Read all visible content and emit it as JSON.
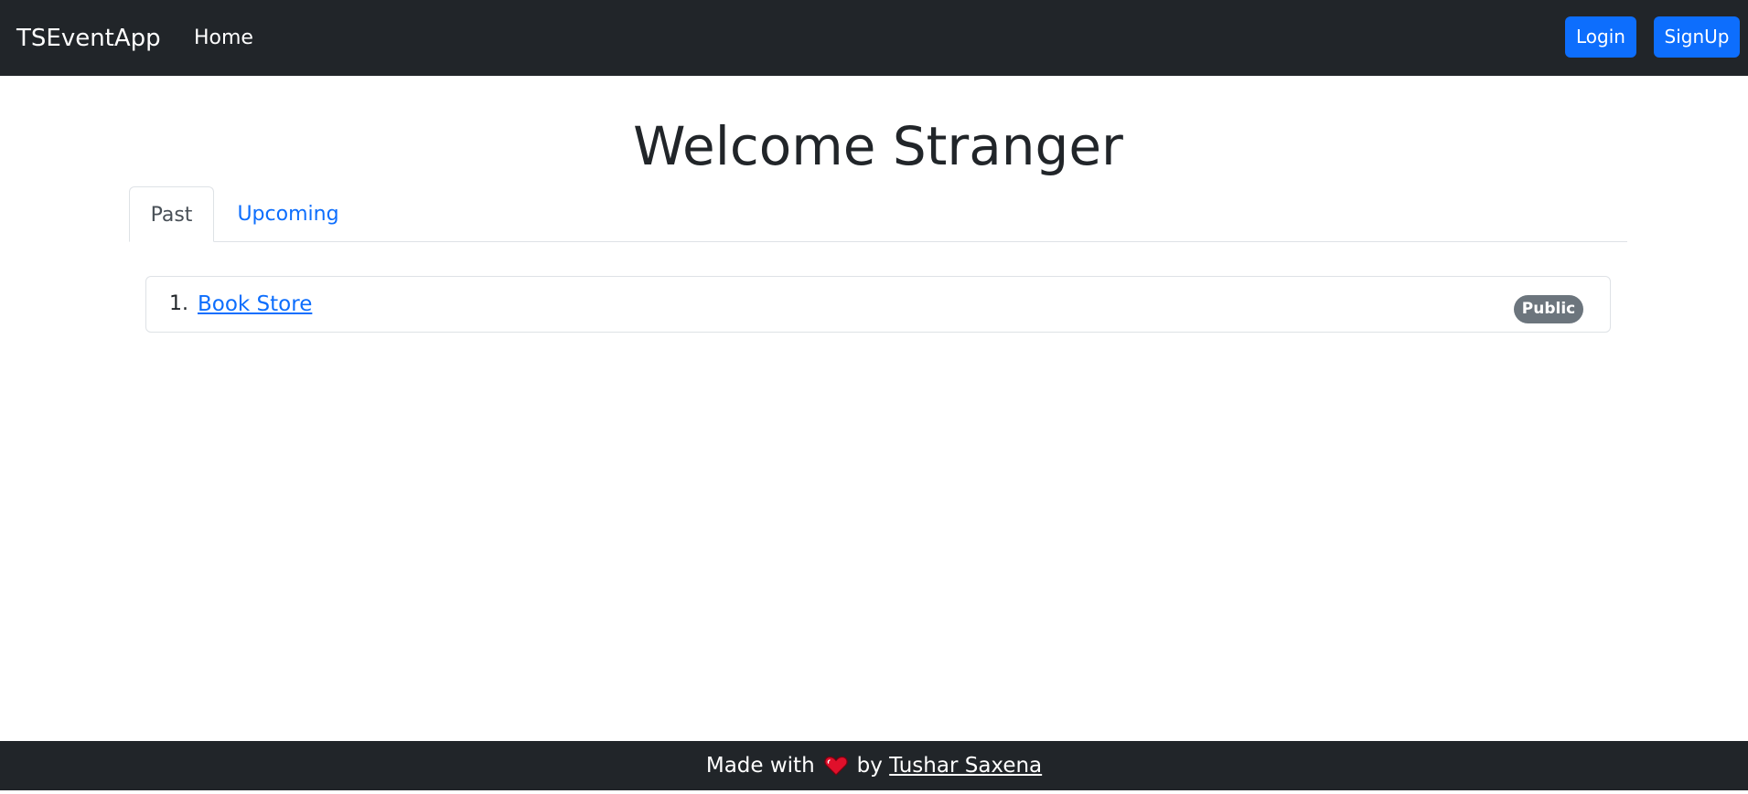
{
  "navbar": {
    "brand": "TSEventApp",
    "links": [
      {
        "label": "Home"
      }
    ],
    "login_label": "Login",
    "signup_label": "SignUp"
  },
  "main": {
    "title": "Welcome Stranger",
    "tabs": [
      {
        "label": "Past",
        "active": true
      },
      {
        "label": "Upcoming",
        "active": false
      }
    ],
    "events": [
      {
        "number": "1.",
        "name": "Book Store",
        "visibility": "Public"
      }
    ]
  },
  "footer": {
    "prefix": "Made with",
    "heart_icon": "heart-icon",
    "by": "by",
    "author": "Tushar Saxena"
  },
  "colors": {
    "navbar_bg": "#212529",
    "primary": "#0d6efd",
    "badge_bg": "#6c757d",
    "heart": "#e0102b"
  }
}
